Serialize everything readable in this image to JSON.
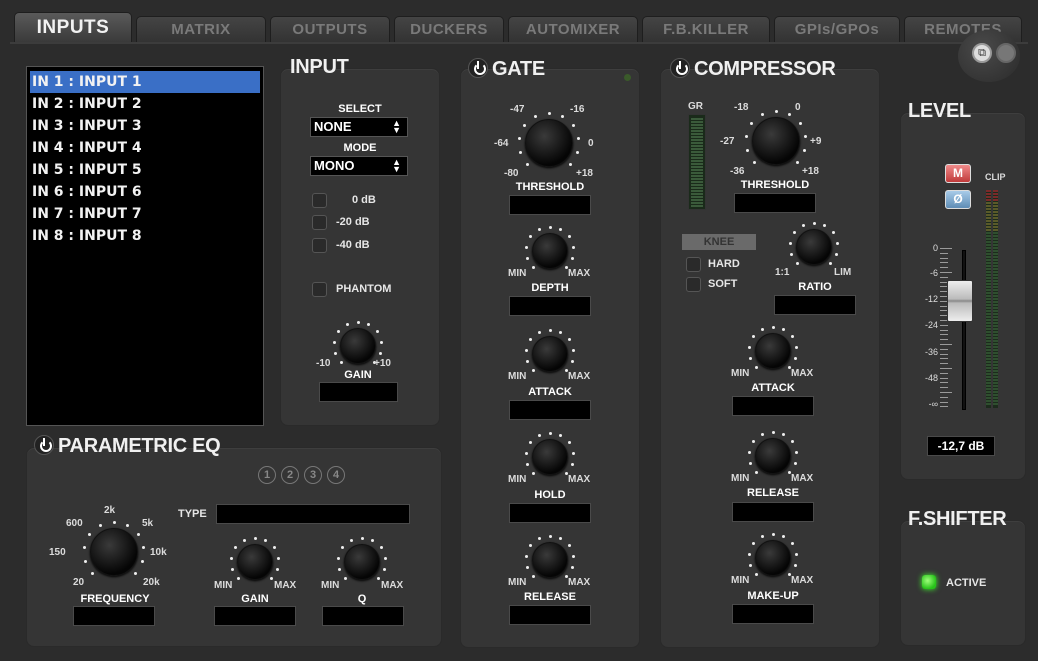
{
  "tabs": [
    "INPUTS",
    "MATRIX",
    "OUTPUTS",
    "DUCKERS",
    "AUTOMIXER",
    "F.B.KILLER",
    "GPIs/GPOs",
    "REMOTES"
  ],
  "active_tab": "INPUTS",
  "input_list": [
    "IN 1 : INPUT 1",
    "IN 2 : INPUT 2",
    "IN 3 : INPUT 3",
    "IN 4 : INPUT 4",
    "IN 5 : INPUT 5",
    "IN 6 : INPUT 6",
    "IN 7 : INPUT 7",
    "IN 8 : INPUT 8"
  ],
  "selected_input": "IN 1 : INPUT 1",
  "input": {
    "title": "INPUT",
    "select_label": "SELECT",
    "select_value": "NONE",
    "mode_label": "MODE",
    "mode_value": "MONO",
    "pad_options": [
      "0 dB",
      "-20 dB",
      "-40 dB"
    ],
    "phantom_label": "PHANTOM",
    "gain": {
      "label": "GAIN",
      "min": "-10",
      "max": "+10"
    }
  },
  "gate": {
    "title": "GATE",
    "threshold": {
      "label": "THRESHOLD",
      "scale": [
        "-47",
        "-16",
        "-64",
        "0",
        "-80",
        "+18"
      ]
    },
    "depth": {
      "label": "DEPTH",
      "min": "MIN",
      "max": "MAX"
    },
    "attack": {
      "label": "ATTACK",
      "min": "MIN",
      "max": "MAX"
    },
    "hold": {
      "label": "HOLD",
      "min": "MIN",
      "max": "MAX"
    },
    "release": {
      "label": "RELEASE",
      "min": "MIN",
      "max": "MAX"
    }
  },
  "compressor": {
    "title": "COMPRESSOR",
    "gr_label": "GR",
    "threshold": {
      "label": "THRESHOLD",
      "scale": [
        "-18",
        "0",
        "-27",
        "+9",
        "-36",
        "+18"
      ]
    },
    "knee_label": "KNEE",
    "knee_options": [
      "HARD",
      "SOFT"
    ],
    "ratio": {
      "label": "RATIO",
      "min": "1:1",
      "max": "LIM"
    },
    "attack": {
      "label": "ATTACK",
      "min": "MIN",
      "max": "MAX"
    },
    "release": {
      "label": "RELEASE",
      "min": "MIN",
      "max": "MAX"
    },
    "makeup": {
      "label": "MAKE-UP",
      "min": "MIN",
      "max": "MAX"
    }
  },
  "level": {
    "title": "LEVEL",
    "mute_label": "M",
    "phase_label": "Ø",
    "clip_label": "CLIP",
    "scale": [
      "0",
      "-6",
      "-12",
      "-24",
      "-36",
      "-48",
      "-∞"
    ],
    "value": "-12,7 dB"
  },
  "eq": {
    "title": "PARAMETRIC EQ",
    "bands": [
      "1",
      "2",
      "3",
      "4"
    ],
    "type_label": "TYPE",
    "frequency": {
      "label": "FREQUENCY",
      "scale": [
        "2k",
        "600",
        "5k",
        "150",
        "10k",
        "20",
        "20k"
      ]
    },
    "gain": {
      "label": "GAIN",
      "min": "MIN",
      "max": "MAX"
    },
    "q": {
      "label": "Q",
      "min": "MIN",
      "max": "MAX"
    }
  },
  "fshifter": {
    "title": "F.SHIFTER",
    "active_label": "ACTIVE"
  },
  "colors": {
    "selection": "#3a6fc6",
    "mute": "#c03a3a",
    "phase": "#5f8db5",
    "active_led": "#28c21a"
  }
}
